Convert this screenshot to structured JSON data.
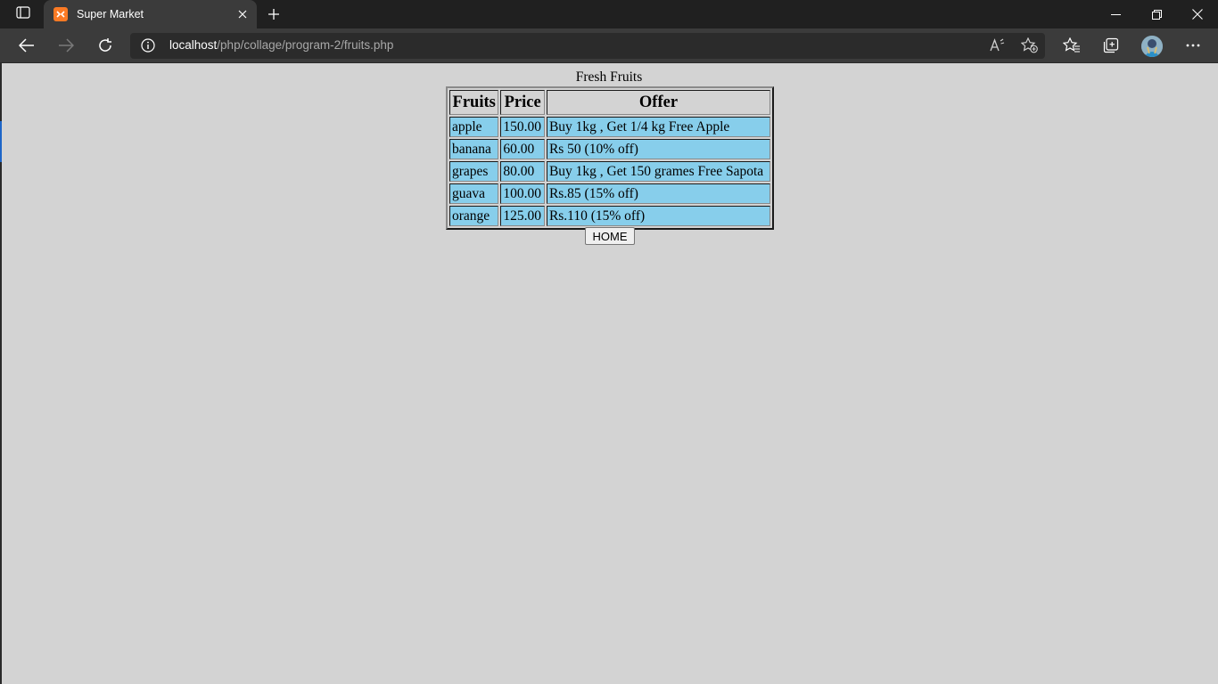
{
  "browser": {
    "tab": {
      "title": "Super Market"
    },
    "address": {
      "host": "localhost",
      "path": "/php/collage/program-2/fruits.php"
    }
  },
  "page": {
    "heading": "Fresh Fruits",
    "table": {
      "headers": [
        "Fruits",
        "Price",
        "Offer"
      ],
      "rows": [
        [
          "apple",
          "150.00",
          "Buy 1kg , Get 1/4 kg Free Apple"
        ],
        [
          "banana",
          "60.00",
          "Rs 50 (10% off)"
        ],
        [
          "grapes",
          "80.00",
          "Buy 1kg , Get 150 grames Free Sapota"
        ],
        [
          "guava",
          "100.00",
          "Rs.85 (15% off)"
        ],
        [
          "orange",
          "125.00",
          "Rs.110 (15% off)"
        ]
      ]
    },
    "home_button": "HOME"
  },
  "colors": {
    "page_background": "#d3d3d3",
    "table_cell": "#87ceeb",
    "browser_frame": "#202020",
    "browser_toolbar": "#3b3b3b",
    "favicon": "#fb7a24"
  },
  "icons": {
    "tab_actions": "tab-actions-icon",
    "favicon": "xampp-icon",
    "tab_close": "close-icon",
    "new_tab": "plus-icon",
    "minimize": "minimize-icon",
    "restore": "restore-icon",
    "close_window": "close-icon",
    "back": "back-arrow-icon",
    "forward": "forward-arrow-icon",
    "refresh": "refresh-icon",
    "site_info": "info-icon",
    "read_aloud": "read-aloud-icon",
    "add_favorite": "add-favorite-icon",
    "favorites": "favorites-icon",
    "collections": "collections-icon",
    "profile": "avatar",
    "more": "more-icon"
  }
}
